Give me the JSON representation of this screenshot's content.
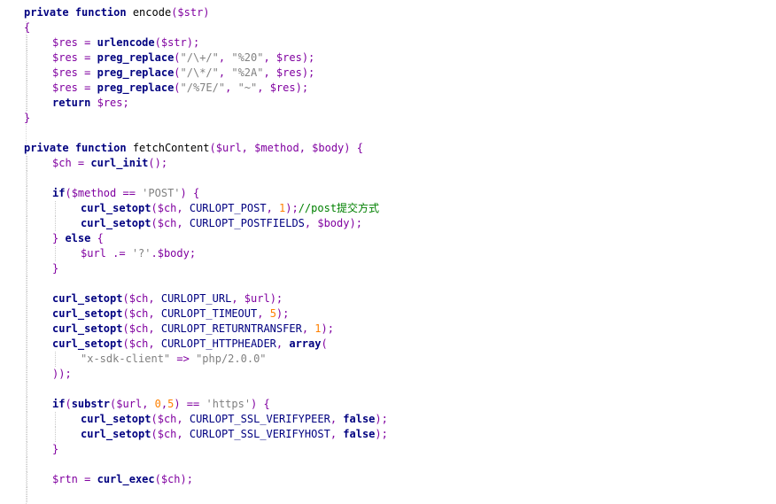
{
  "editor": {
    "colors": {
      "keyword": "#000080",
      "variable": "#8000a0",
      "string": "#808080",
      "number": "#ff8000",
      "comment": "#008000",
      "background": "#ffffff"
    },
    "lines": [
      {
        "indent": 0,
        "tokens": [
          [
            "kw",
            "private"
          ],
          [
            "id",
            " "
          ],
          [
            "kw",
            "function"
          ],
          [
            "id",
            " encode"
          ],
          [
            "punc",
            "($str)"
          ]
        ]
      },
      {
        "indent": 0,
        "tokens": [
          [
            "punc",
            "{"
          ]
        ]
      },
      {
        "indent": 1,
        "tokens": [
          [
            "var",
            "$res"
          ],
          [
            "punc",
            " = "
          ],
          [
            "fn",
            "urlencode"
          ],
          [
            "punc",
            "("
          ],
          [
            "var",
            "$str"
          ],
          [
            "punc",
            ");"
          ]
        ]
      },
      {
        "indent": 1,
        "tokens": [
          [
            "var",
            "$res"
          ],
          [
            "punc",
            " = "
          ],
          [
            "fn",
            "preg_replace"
          ],
          [
            "punc",
            "("
          ],
          [
            "str",
            "\"/\\+/\""
          ],
          [
            "punc",
            ", "
          ],
          [
            "str",
            "\"%20\""
          ],
          [
            "punc",
            ", "
          ],
          [
            "var",
            "$res"
          ],
          [
            "punc",
            ");"
          ]
        ]
      },
      {
        "indent": 1,
        "tokens": [
          [
            "var",
            "$res"
          ],
          [
            "punc",
            " = "
          ],
          [
            "fn",
            "preg_replace"
          ],
          [
            "punc",
            "("
          ],
          [
            "str",
            "\"/\\*/\""
          ],
          [
            "punc",
            ", "
          ],
          [
            "str",
            "\"%2A\""
          ],
          [
            "punc",
            ", "
          ],
          [
            "var",
            "$res"
          ],
          [
            "punc",
            ");"
          ]
        ]
      },
      {
        "indent": 1,
        "tokens": [
          [
            "var",
            "$res"
          ],
          [
            "punc",
            " = "
          ],
          [
            "fn",
            "preg_replace"
          ],
          [
            "punc",
            "("
          ],
          [
            "str",
            "\"/%7E/\""
          ],
          [
            "punc",
            ", "
          ],
          [
            "str",
            "\"~\""
          ],
          [
            "punc",
            ", "
          ],
          [
            "var",
            "$res"
          ],
          [
            "punc",
            ");"
          ]
        ]
      },
      {
        "indent": 1,
        "tokens": [
          [
            "kw",
            "return"
          ],
          [
            "id",
            " "
          ],
          [
            "var",
            "$res"
          ],
          [
            "punc",
            ";"
          ]
        ]
      },
      {
        "indent": 0,
        "tokens": [
          [
            "punc",
            "}"
          ]
        ]
      },
      {
        "indent": 0,
        "tokens": []
      },
      {
        "indent": 0,
        "tokens": [
          [
            "kw",
            "private"
          ],
          [
            "id",
            " "
          ],
          [
            "kw",
            "function"
          ],
          [
            "id",
            " fetchContent"
          ],
          [
            "punc",
            "("
          ],
          [
            "var",
            "$url"
          ],
          [
            "punc",
            ", "
          ],
          [
            "var",
            "$method"
          ],
          [
            "punc",
            ", "
          ],
          [
            "var",
            "$body"
          ],
          [
            "punc",
            ") {"
          ]
        ]
      },
      {
        "indent": 1,
        "tokens": [
          [
            "var",
            "$ch"
          ],
          [
            "punc",
            " = "
          ],
          [
            "fn",
            "curl_init"
          ],
          [
            "punc",
            "();"
          ]
        ]
      },
      {
        "indent": 1,
        "tokens": []
      },
      {
        "indent": 1,
        "tokens": [
          [
            "kw",
            "if"
          ],
          [
            "punc",
            "("
          ],
          [
            "var",
            "$method"
          ],
          [
            "punc",
            " == "
          ],
          [
            "str",
            "'POST'"
          ],
          [
            "punc",
            ") {"
          ]
        ]
      },
      {
        "indent": 2,
        "tokens": [
          [
            "fn",
            "curl_setopt"
          ],
          [
            "punc",
            "("
          ],
          [
            "var",
            "$ch"
          ],
          [
            "punc",
            ", "
          ],
          [
            "const",
            "CURLOPT_POST"
          ],
          [
            "punc",
            ", "
          ],
          [
            "num",
            "1"
          ],
          [
            "punc",
            ");"
          ],
          [
            "cmt",
            "//post提交方式"
          ]
        ]
      },
      {
        "indent": 2,
        "tokens": [
          [
            "fn",
            "curl_setopt"
          ],
          [
            "punc",
            "("
          ],
          [
            "var",
            "$ch"
          ],
          [
            "punc",
            ", "
          ],
          [
            "const",
            "CURLOPT_POSTFIELDS"
          ],
          [
            "punc",
            ", "
          ],
          [
            "var",
            "$body"
          ],
          [
            "punc",
            ");"
          ]
        ]
      },
      {
        "indent": 1,
        "tokens": [
          [
            "punc",
            "} "
          ],
          [
            "kw",
            "else"
          ],
          [
            "punc",
            " {"
          ]
        ]
      },
      {
        "indent": 2,
        "tokens": [
          [
            "var",
            "$url"
          ],
          [
            "punc",
            " .= "
          ],
          [
            "str",
            "'?'"
          ],
          [
            "punc",
            "."
          ],
          [
            "var",
            "$body"
          ],
          [
            "punc",
            ";"
          ]
        ]
      },
      {
        "indent": 1,
        "tokens": [
          [
            "punc",
            "}"
          ]
        ]
      },
      {
        "indent": 1,
        "tokens": []
      },
      {
        "indent": 1,
        "tokens": [
          [
            "fn",
            "curl_setopt"
          ],
          [
            "punc",
            "("
          ],
          [
            "var",
            "$ch"
          ],
          [
            "punc",
            ", "
          ],
          [
            "const",
            "CURLOPT_URL"
          ],
          [
            "punc",
            ", "
          ],
          [
            "var",
            "$url"
          ],
          [
            "punc",
            ");"
          ]
        ]
      },
      {
        "indent": 1,
        "tokens": [
          [
            "fn",
            "curl_setopt"
          ],
          [
            "punc",
            "("
          ],
          [
            "var",
            "$ch"
          ],
          [
            "punc",
            ", "
          ],
          [
            "const",
            "CURLOPT_TIMEOUT"
          ],
          [
            "punc",
            ", "
          ],
          [
            "num",
            "5"
          ],
          [
            "punc",
            ");"
          ]
        ]
      },
      {
        "indent": 1,
        "tokens": [
          [
            "fn",
            "curl_setopt"
          ],
          [
            "punc",
            "("
          ],
          [
            "var",
            "$ch"
          ],
          [
            "punc",
            ", "
          ],
          [
            "const",
            "CURLOPT_RETURNTRANSFER"
          ],
          [
            "punc",
            ", "
          ],
          [
            "num",
            "1"
          ],
          [
            "punc",
            ");"
          ]
        ]
      },
      {
        "indent": 1,
        "tokens": [
          [
            "fn",
            "curl_setopt"
          ],
          [
            "punc",
            "("
          ],
          [
            "var",
            "$ch"
          ],
          [
            "punc",
            ", "
          ],
          [
            "const",
            "CURLOPT_HTTPHEADER"
          ],
          [
            "punc",
            ", "
          ],
          [
            "kw",
            "array"
          ],
          [
            "punc",
            "("
          ]
        ]
      },
      {
        "indent": 2,
        "tokens": [
          [
            "str",
            "\"x-sdk-client\""
          ],
          [
            "punc",
            " => "
          ],
          [
            "str",
            "\"php/2.0.0\""
          ]
        ]
      },
      {
        "indent": 1,
        "tokens": [
          [
            "punc",
            "));"
          ]
        ]
      },
      {
        "indent": 1,
        "tokens": []
      },
      {
        "indent": 1,
        "tokens": [
          [
            "kw",
            "if"
          ],
          [
            "punc",
            "("
          ],
          [
            "fn",
            "substr"
          ],
          [
            "punc",
            "("
          ],
          [
            "var",
            "$url"
          ],
          [
            "punc",
            ", "
          ],
          [
            "num",
            "0"
          ],
          [
            "punc",
            ","
          ],
          [
            "num",
            "5"
          ],
          [
            "punc",
            ") == "
          ],
          [
            "str",
            "'https'"
          ],
          [
            "punc",
            ") {"
          ]
        ]
      },
      {
        "indent": 2,
        "tokens": [
          [
            "fn",
            "curl_setopt"
          ],
          [
            "punc",
            "("
          ],
          [
            "var",
            "$ch"
          ],
          [
            "punc",
            ", "
          ],
          [
            "const",
            "CURLOPT_SSL_VERIFYPEER"
          ],
          [
            "punc",
            ", "
          ],
          [
            "kw",
            "false"
          ],
          [
            "punc",
            ");"
          ]
        ]
      },
      {
        "indent": 2,
        "tokens": [
          [
            "fn",
            "curl_setopt"
          ],
          [
            "punc",
            "("
          ],
          [
            "var",
            "$ch"
          ],
          [
            "punc",
            ", "
          ],
          [
            "const",
            "CURLOPT_SSL_VERIFYHOST"
          ],
          [
            "punc",
            ", "
          ],
          [
            "kw",
            "false"
          ],
          [
            "punc",
            ");"
          ]
        ]
      },
      {
        "indent": 1,
        "tokens": [
          [
            "punc",
            "}"
          ]
        ]
      },
      {
        "indent": 1,
        "tokens": []
      },
      {
        "indent": 1,
        "tokens": [
          [
            "var",
            "$rtn"
          ],
          [
            "punc",
            " = "
          ],
          [
            "fn",
            "curl_exec"
          ],
          [
            "punc",
            "("
          ],
          [
            "var",
            "$ch"
          ],
          [
            "punc",
            ");"
          ]
        ]
      },
      {
        "indent": 1,
        "tokens": []
      }
    ]
  }
}
